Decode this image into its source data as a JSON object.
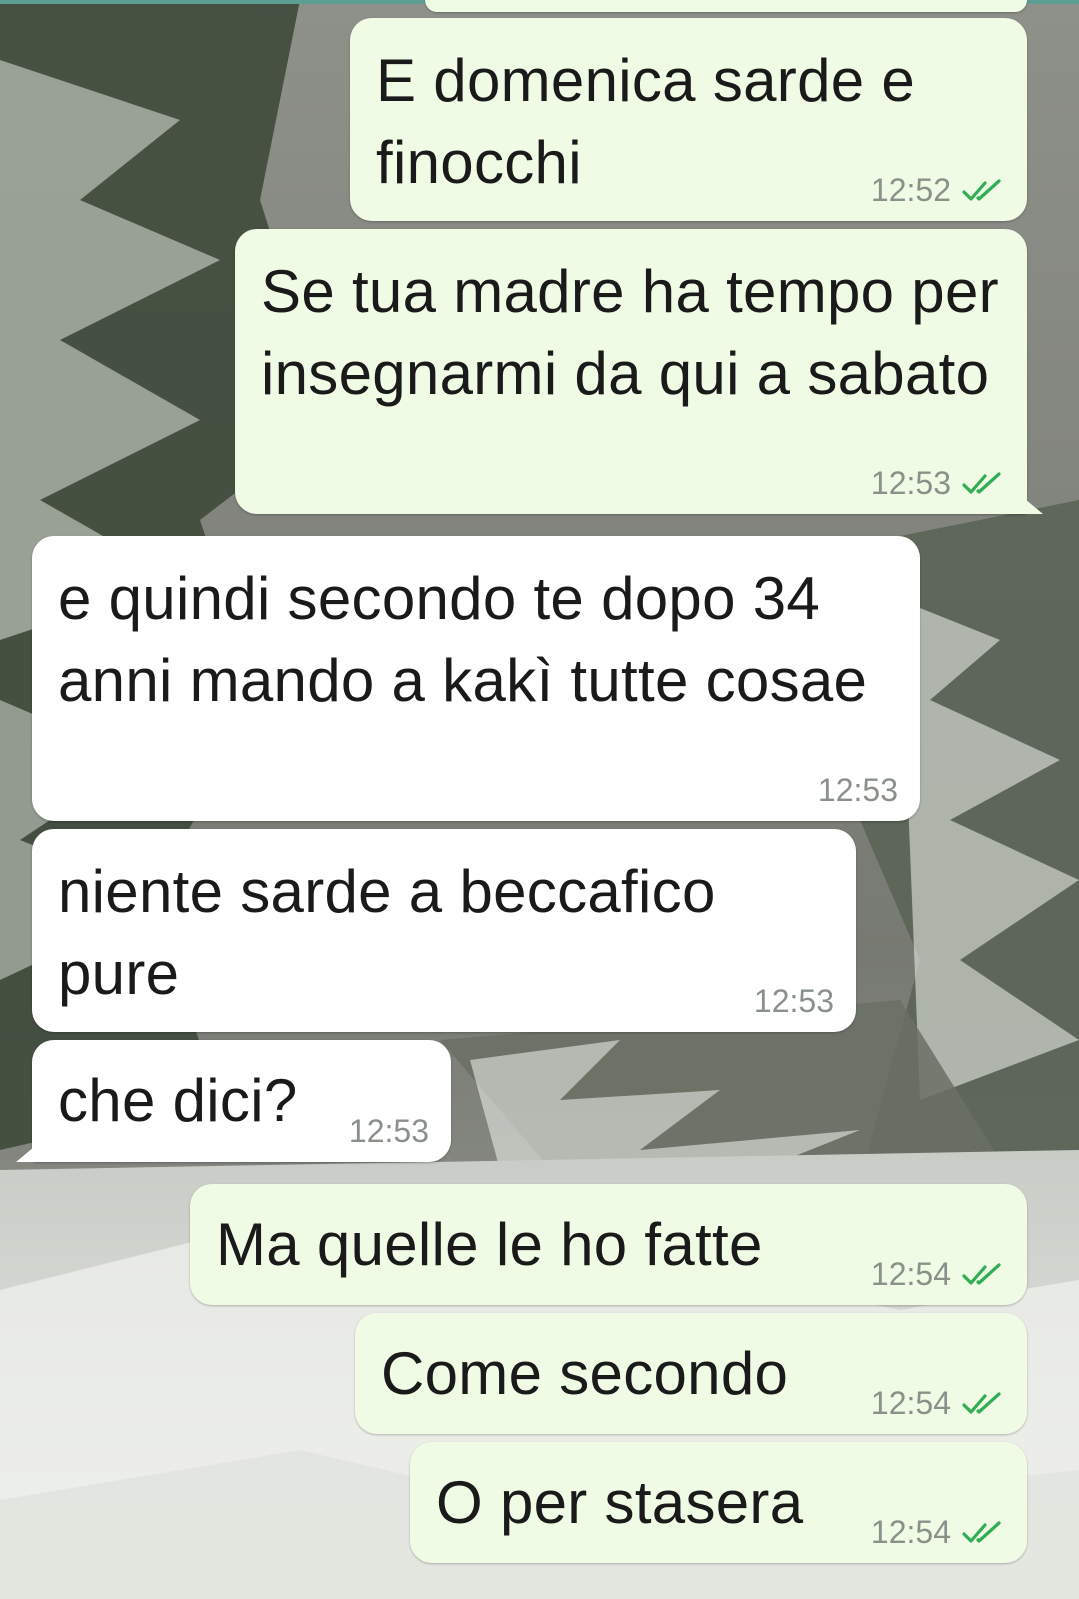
{
  "colors": {
    "outgoing_bubble": "#f0fbe6",
    "incoming_bubble": "#ffffff",
    "read_ticks": "#2fae53",
    "timestamp": "#8a918a"
  },
  "icons": {
    "read_receipt": "double-check-icon"
  },
  "messages": [
    {
      "direction": "outgoing",
      "text": "E domenica sarde e finocchi",
      "time": "12:52",
      "read": true
    },
    {
      "direction": "outgoing",
      "text": "Se tua madre ha tempo per insegnarmi da qui a sabato",
      "time": "12:53",
      "read": true
    },
    {
      "direction": "incoming",
      "text": "e quindi secondo te dopo 34 anni mando a kakì tutte cosae",
      "time": "12:53"
    },
    {
      "direction": "incoming",
      "text": "niente sarde a beccafico pure",
      "time": "12:53"
    },
    {
      "direction": "incoming",
      "text": "che dici?",
      "time": "12:53"
    },
    {
      "direction": "outgoing",
      "text": "Ma quelle le ho fatte",
      "time": "12:54",
      "read": true
    },
    {
      "direction": "outgoing",
      "text": "Come secondo",
      "time": "12:54",
      "read": true
    },
    {
      "direction": "outgoing",
      "text": "O per stasera",
      "time": "12:54",
      "read": true
    }
  ]
}
